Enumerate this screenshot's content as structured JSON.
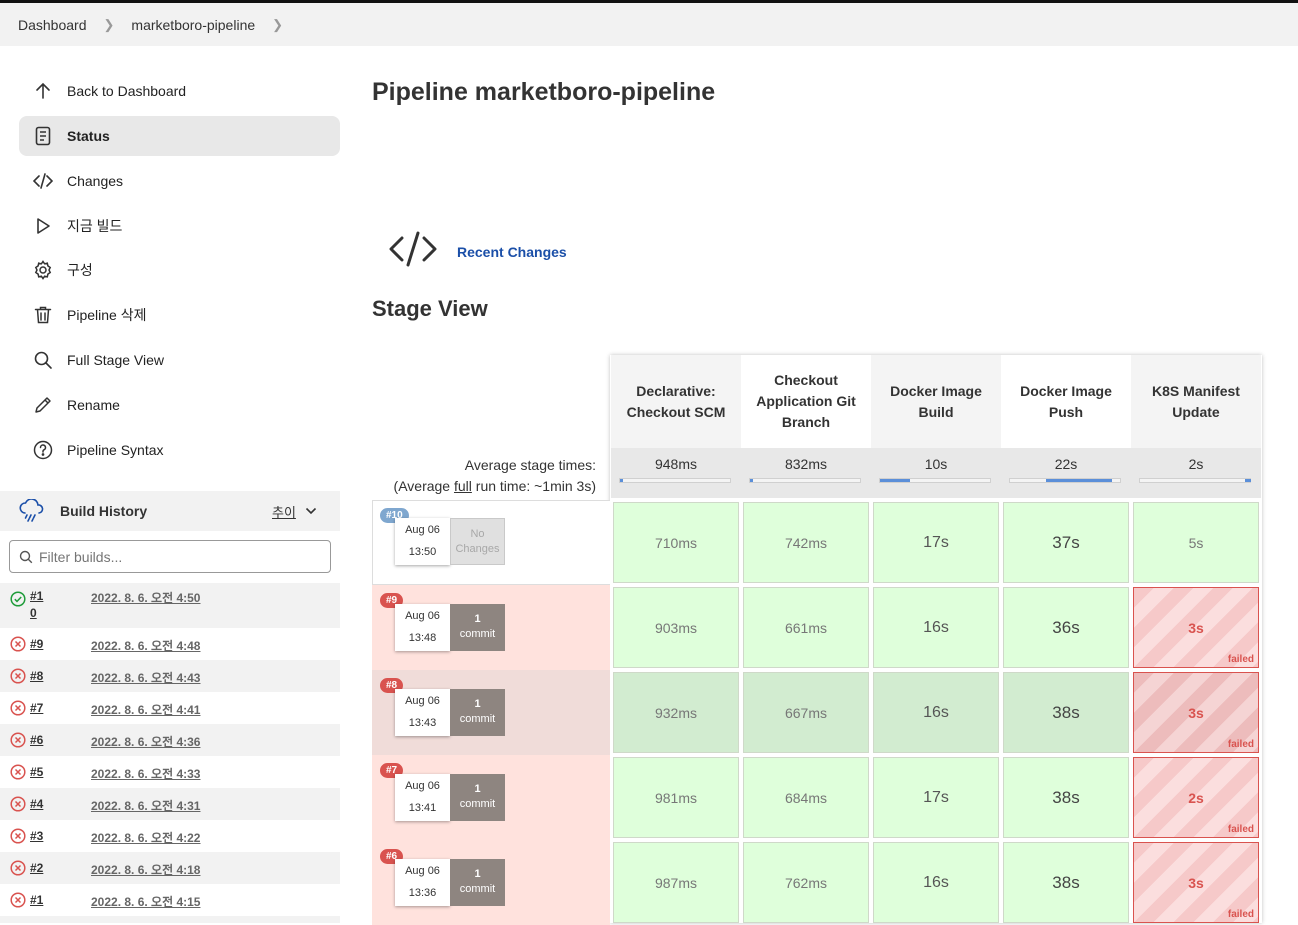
{
  "breadcrumb": {
    "items": [
      "Dashboard",
      "marketboro-pipeline"
    ]
  },
  "sidebar": {
    "items": [
      {
        "label": "Back to Dashboard",
        "icon": "arrow-up-icon"
      },
      {
        "label": "Status",
        "icon": "document-icon",
        "active": true
      },
      {
        "label": "Changes",
        "icon": "code-icon"
      },
      {
        "label": "지금 빌드",
        "icon": "play-icon"
      },
      {
        "label": "구성",
        "icon": "gear-icon"
      },
      {
        "label": "Pipeline 삭제",
        "icon": "trash-icon"
      },
      {
        "label": "Full Stage View",
        "icon": "search-icon"
      },
      {
        "label": "Rename",
        "icon": "pencil-icon"
      },
      {
        "label": "Pipeline Syntax",
        "icon": "help-icon"
      }
    ]
  },
  "build_history": {
    "title": "Build History",
    "trend_label": "추이",
    "filter_placeholder": "Filter builds...",
    "builds": [
      {
        "num": "#1",
        "num2": "0",
        "date": "2022. 8. 6. 오전 4:50",
        "status": "success"
      },
      {
        "num": "#9",
        "date": "2022. 8. 6. 오전 4:48",
        "status": "failed"
      },
      {
        "num": "#8",
        "date": "2022. 8. 6. 오전 4:43",
        "status": "failed"
      },
      {
        "num": "#7",
        "date": "2022. 8. 6. 오전 4:41",
        "status": "failed"
      },
      {
        "num": "#6",
        "date": "2022. 8. 6. 오전 4:36",
        "status": "failed"
      },
      {
        "num": "#5",
        "date": "2022. 8. 6. 오전 4:33",
        "status": "failed"
      },
      {
        "num": "#4",
        "date": "2022. 8. 6. 오전 4:31",
        "status": "failed"
      },
      {
        "num": "#3",
        "date": "2022. 8. 6. 오전 4:22",
        "status": "failed"
      },
      {
        "num": "#2",
        "date": "2022. 8. 6. 오전 4:18",
        "status": "failed"
      },
      {
        "num": "#1",
        "date": "2022. 8. 6. 오전 4:15",
        "status": "failed"
      }
    ]
  },
  "main": {
    "title": "Pipeline marketboro-pipeline",
    "recent_changes": "Recent Changes",
    "stage_view_title": "Stage View"
  },
  "stage_view": {
    "avg_label_line1": "Average stage times:",
    "avg_label_pre": "(Average ",
    "avg_label_link": "full",
    "avg_label_post": " run time: ~1min 3s)",
    "stages": [
      {
        "name": "Declarative: Checkout SCM",
        "avg": "948ms",
        "bar_fraction": 0.02
      },
      {
        "name": "Checkout Application Git Branch",
        "avg": "832ms",
        "bar_fraction": 0.02
      },
      {
        "name": "Docker Image Build",
        "avg": "10s",
        "bar_fraction": 0.27
      },
      {
        "name": "Docker Image Push",
        "avg": "22s",
        "bar_fraction": 0.6
      },
      {
        "name": "K8S Manifest Update",
        "avg": "2s",
        "bar_fraction": 0.05
      }
    ],
    "runs": [
      {
        "badge": "#10",
        "date": "Aug 06",
        "time": "13:50",
        "changes": "No Changes",
        "commit_count": "",
        "commit_word": "",
        "status": "success",
        "cells": [
          {
            "t": "710ms"
          },
          {
            "t": "742ms"
          },
          {
            "t": "17s"
          },
          {
            "t": "37s"
          },
          {
            "t": "5s"
          }
        ]
      },
      {
        "badge": "#9",
        "date": "Aug 06",
        "time": "13:48",
        "changes": "",
        "commit_count": "1",
        "commit_word": "commit",
        "status": "failed",
        "cells": [
          {
            "t": "903ms"
          },
          {
            "t": "661ms"
          },
          {
            "t": "16s"
          },
          {
            "t": "36s"
          },
          {
            "t": "3s",
            "failed": true
          }
        ]
      },
      {
        "badge": "#8",
        "date": "Aug 06",
        "time": "13:43",
        "changes": "",
        "commit_count": "1",
        "commit_word": "commit",
        "status": "failed",
        "cells": [
          {
            "t": "932ms"
          },
          {
            "t": "667ms"
          },
          {
            "t": "16s"
          },
          {
            "t": "38s"
          },
          {
            "t": "3s",
            "failed": true
          }
        ]
      },
      {
        "badge": "#7",
        "date": "Aug 06",
        "time": "13:41",
        "changes": "",
        "commit_count": "1",
        "commit_word": "commit",
        "status": "failed",
        "cells": [
          {
            "t": "981ms"
          },
          {
            "t": "684ms"
          },
          {
            "t": "17s"
          },
          {
            "t": "38s"
          },
          {
            "t": "2s",
            "failed": true
          }
        ]
      },
      {
        "badge": "#6",
        "date": "Aug 06",
        "time": "13:36",
        "changes": "",
        "commit_count": "1",
        "commit_word": "commit",
        "status": "failed",
        "cells": [
          {
            "t": "987ms"
          },
          {
            "t": "762ms"
          },
          {
            "t": "16s"
          },
          {
            "t": "38s"
          },
          {
            "t": "3s",
            "failed": true
          }
        ]
      }
    ],
    "failed_label": "failed"
  },
  "colors": {
    "accent": "#1b4fa8",
    "success": "#1f9c3a",
    "failure": "#d9534f",
    "stage_success_bg": "#dfffdb",
    "row_failed_bg": "#ffe2dd",
    "badge_success": "#7fa7cf"
  }
}
